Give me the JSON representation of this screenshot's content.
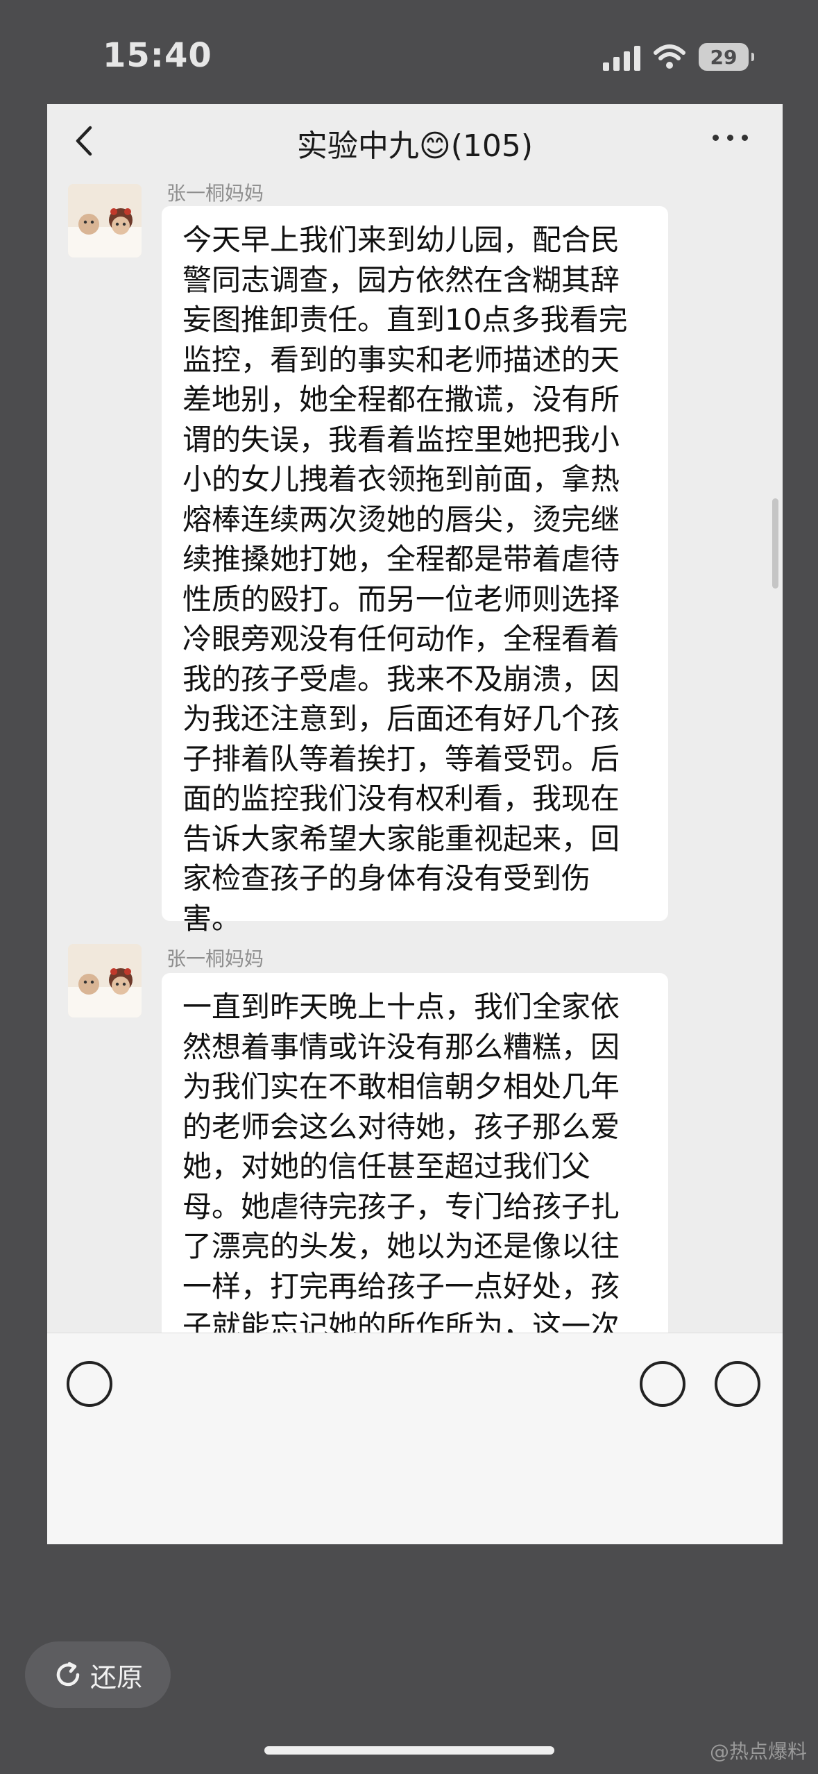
{
  "status_bar": {
    "time": "15:40",
    "battery": "29"
  },
  "header": {
    "title": "实验中九😊(105)"
  },
  "messages": [
    {
      "sender": "张一桐妈妈",
      "text": "今天早上我们来到幼儿园，配合民警同志调查，园方依然在含糊其辞妄图推卸责任。直到10点多我看完监控，看到的事实和老师描述的天差地别，她全程都在撒谎，没有所谓的失误，我看着监控里她把我小小的女儿拽着衣领拖到前面，拿热熔棒连续两次烫她的唇尖，烫完继续推搡她打她，全程都是带着虐待性质的殴打。而另一位老师则选择冷眼旁观没有任何动作，全程看着我的孩子受虐。我来不及崩溃，因为我还注意到，后面还有好几个孩子排着队等着挨打，等着受罚。后面的监控我们没有权利看，我现在告诉大家希望大家能重视起来，回家检查孩子的身体有没有受到伤害。"
    },
    {
      "sender": "张一桐妈妈",
      "text": "一直到昨天晚上十点，我们全家依然想着事情或许没有那么糟糕，因为我们实在不敢相信朝夕相处几年的老师会这么对待她，孩子那么爱她，对她的信任甚至超过我们父母。她虐待完孩子，专门给孩子扎了漂亮的头发，她以为还是像以往一样，打完再给孩子一点好处，孩子就能忘记她的所作所为，这一次如果不是伤口太严重，我们根本不会知道一直以来自己的孩子在学校一直是过着这样的生活。"
    }
  ],
  "restore_button": {
    "label": "还原"
  },
  "watermark": "@热点爆料"
}
